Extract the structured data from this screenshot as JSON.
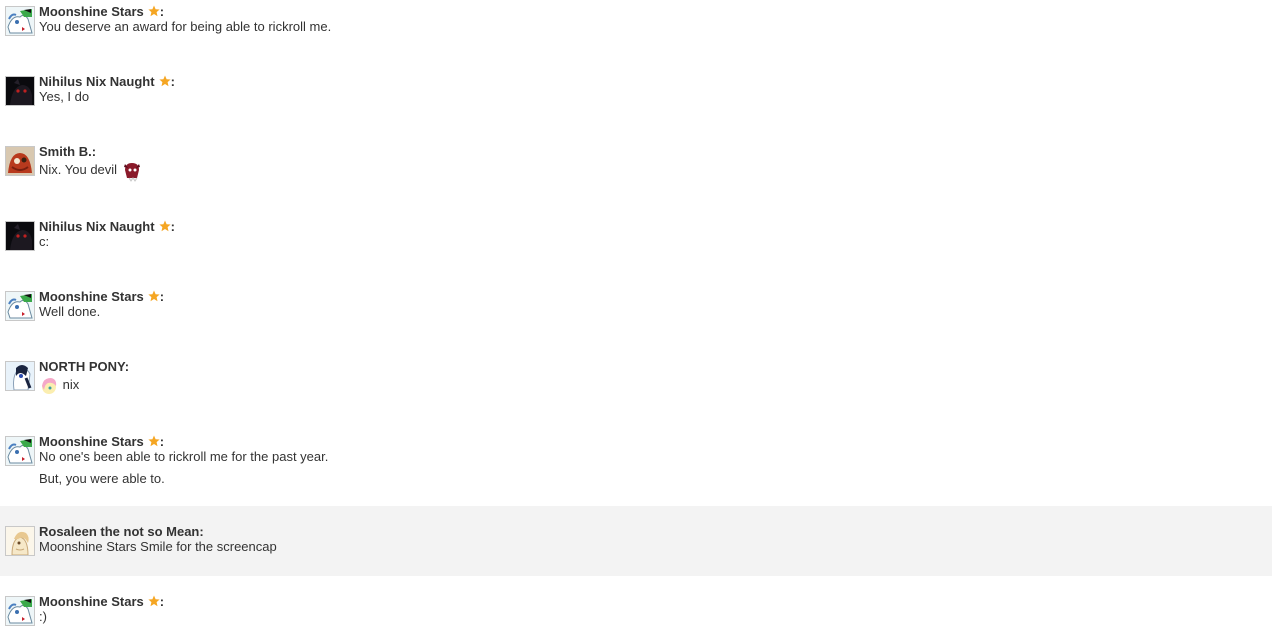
{
  "messages": [
    {
      "user": "Moonshine Stars",
      "starred": true,
      "avatar": "moonshine-avatar",
      "lines": [
        "You deserve an award for being able to rickroll me."
      ]
    },
    {
      "user": "Nihilus Nix Naught",
      "starred": true,
      "avatar": "nihilus-avatar",
      "lines": [
        "Yes, I do"
      ]
    },
    {
      "user": "Smith B.",
      "starred": false,
      "avatar": "smith-avatar",
      "lines": [
        "Nix. You devil"
      ],
      "emote": "devil-pony-emote"
    },
    {
      "user": "Nihilus Nix Naught",
      "starred": true,
      "avatar": "nihilus-avatar",
      "lines": [
        "c:"
      ]
    },
    {
      "user": "Moonshine Stars",
      "starred": true,
      "avatar": "moonshine-avatar",
      "lines": [
        "Well done."
      ]
    },
    {
      "user": "NORTH PONY",
      "starred": false,
      "avatar": "north-pony-avatar",
      "lines": [
        "nix"
      ],
      "emote": "fluttershy-emote"
    },
    {
      "user": "Moonshine Stars",
      "starred": true,
      "avatar": "moonshine-avatar",
      "lines": [
        "No one's been able to rickroll me for the past year.",
        "But, you were able to."
      ]
    },
    {
      "user": "Rosaleen the not so Mean",
      "starred": false,
      "avatar": "rosaleen-avatar",
      "highlighted": true,
      "lines": [
        "Moonshine Stars Smile for the screencap"
      ]
    },
    {
      "user": "Moonshine Stars",
      "starred": true,
      "avatar": "moonshine-avatar",
      "lines": [
        ":)"
      ]
    }
  ],
  "separator": ":",
  "colors": {
    "star": "#f5a623",
    "highlight_bg": "#f3f3f3",
    "text": "#333333"
  }
}
